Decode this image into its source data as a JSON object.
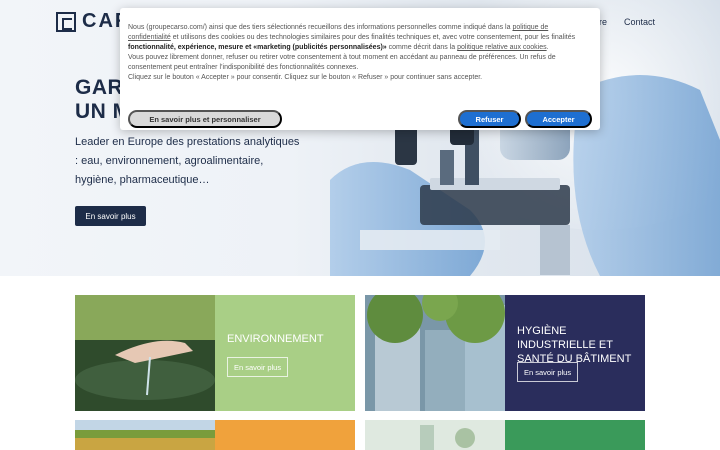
{
  "brand": {
    "name_visible": "CARS",
    "mark": "logo-mark"
  },
  "nav": {
    "item_partial": "ère",
    "contact": "Contact"
  },
  "hero": {
    "title_line1": "GARA",
    "title_line2": "UN M",
    "description": "Leader en Europe des prestations analytiques : eau, environnement, agroalimentaire, hygiène, pharmaceutique…",
    "cta": "En savoir plus"
  },
  "cards": [
    {
      "title": "Environnement",
      "cta": "En savoir plus",
      "panel_color": "#a9cf86"
    },
    {
      "title": "Hygiène industrielle et santé du bâtiment",
      "cta": "En savoir plus",
      "panel_color": "#2a2d5c"
    }
  ],
  "cookie": {
    "p1_a": "Nous (groupecarso.com/) ainsi que des tiers sélectionnés recueillons des informations personnelles comme indiqué dans la ",
    "p1_link1": "politique de confidentialité",
    "p1_b": " et utilisons des cookies ou des technologies similaires pour des finalités techniques et, avec votre consentement, pour les finalités ",
    "p1_bold": "fonctionnalité, expérience, mesure et «marketing (publicités personnalisées)»",
    "p1_c": " comme décrit dans la ",
    "p1_link2": "politique relative aux cookies",
    "p1_d": ".",
    "p2": "Vous pouvez librement donner, refuser ou retirer votre consentement à tout moment en accédant au panneau de préférences. Un refus de consentement peut entraîner l’indisponibilité des fonctionnalités connexes.",
    "p3": "Cliquez sur le bouton « Accepter » pour consentir. Cliquez sur le bouton « Refuser » pour continuer sans accepter.",
    "btn_more": "En savoir plus et personnaliser",
    "btn_refuse": "Refuser",
    "btn_accept": "Accepter",
    "accent": "#1e6fd1"
  },
  "colors": {
    "navy": "#1d2c48"
  }
}
